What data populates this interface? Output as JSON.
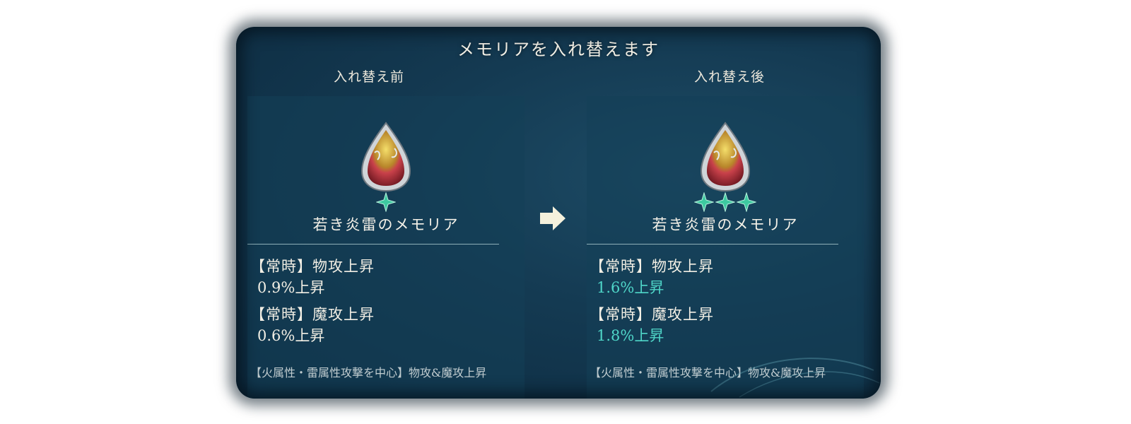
{
  "dialog": {
    "title": "メモリアを入れ替えます"
  },
  "before": {
    "label": "入れ替え前",
    "memoria_name": "若き炎雷のメモリア",
    "rarity_stars": 1,
    "effects": [
      {
        "name": "【常時】物攻上昇",
        "value": "0.9%上昇",
        "improved": false
      },
      {
        "name": "【常時】魔攻上昇",
        "value": "0.6%上昇",
        "improved": false
      }
    ],
    "cutoff_text": "【火属性・雷属性攻撃を中心】物攻&魔攻上昇"
  },
  "after": {
    "label": "入れ替え後",
    "memoria_name": "若き炎雷のメモリア",
    "rarity_stars": 3,
    "effects": [
      {
        "name": "【常時】物攻上昇",
        "value": "1.6%上昇",
        "improved": true
      },
      {
        "name": "【常時】魔攻上昇",
        "value": "1.8%上昇",
        "improved": true
      }
    ],
    "cutoff_text": "【火属性・雷属性攻撃を中心】物攻&魔攻上昇"
  },
  "icons": {
    "arrow": "right-arrow-icon",
    "gem": "memoria-pendant-icon",
    "star": "rarity-star-icon"
  },
  "colors": {
    "improved_value": "#4fd6c8",
    "panel_bg": "#143a52",
    "text": "#f1eee4"
  }
}
